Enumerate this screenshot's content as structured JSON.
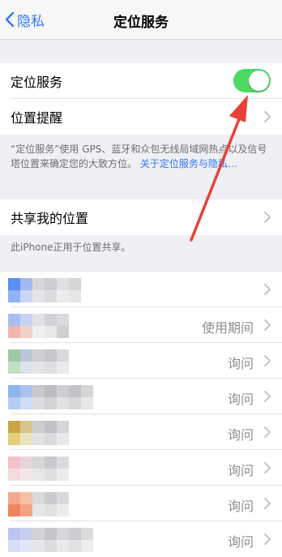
{
  "nav": {
    "back_label": "隐私",
    "title": "定位服务"
  },
  "location_group": {
    "location_services_label": "定位服务",
    "location_services_on": true,
    "location_alerts_label": "位置提醒"
  },
  "footnote1": {
    "text": "“定位服务”使用 GPS、蓝牙和众包无线局域网热点以及信号塔位置来确定您的大致方位。",
    "link": "关于定位服务与隐私…"
  },
  "share": {
    "label": "共享我的位置"
  },
  "footnote2": {
    "text": "此iPhone正用于位置共享。"
  },
  "apps": [
    {
      "status": ""
    },
    {
      "status": "使用期间"
    },
    {
      "status": "询问"
    },
    {
      "status": "询问"
    },
    {
      "status": "询问"
    },
    {
      "status": "询问"
    },
    {
      "status": "询问"
    },
    {
      "status": "询问"
    }
  ],
  "colors": {
    "accent": "#3478f6",
    "toggle_on": "#4cd964",
    "annotation_arrow": "#e8413a"
  }
}
